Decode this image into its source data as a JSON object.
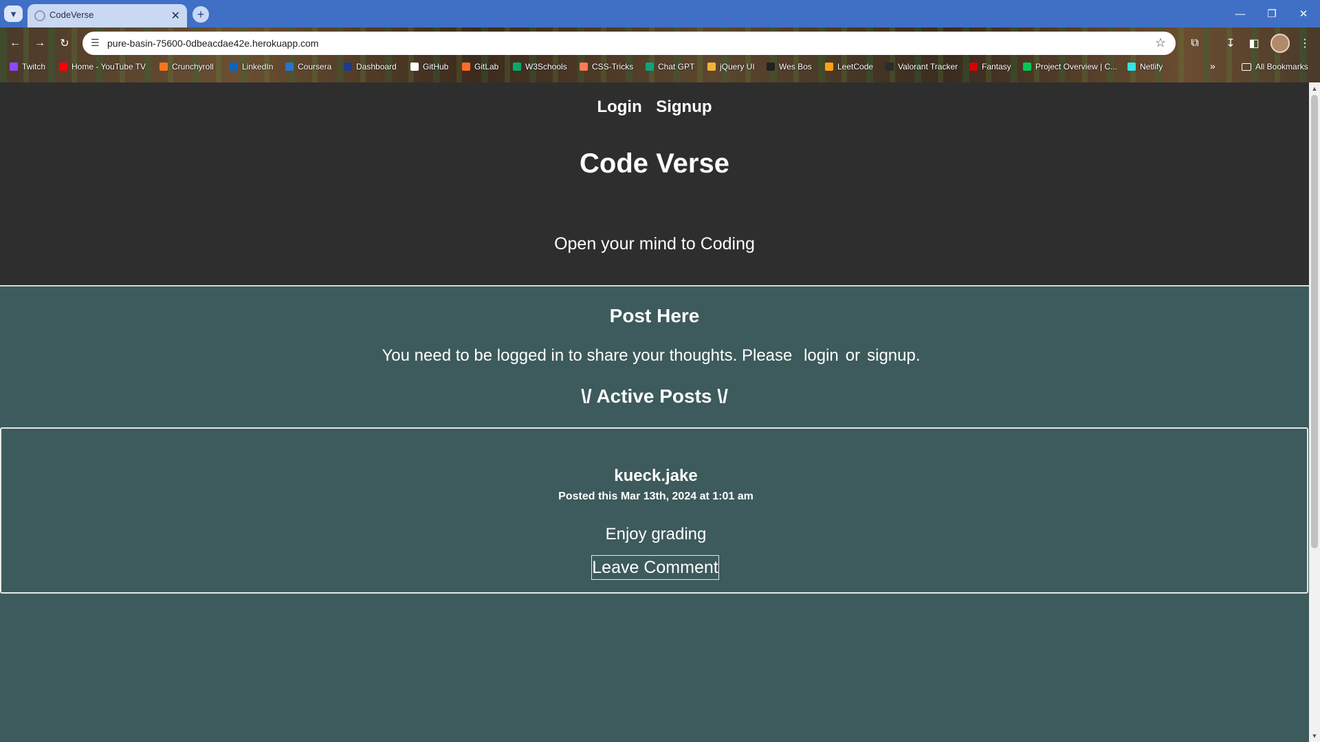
{
  "browser": {
    "tab_title": "CodeVerse",
    "new_tab_symbol": "+",
    "url": "pure-basin-75600-0dbeacdae42e.herokuapp.com",
    "bookmarks": [
      {
        "label": "Twitch",
        "icon": "twitch-icon",
        "color": "#9146ff"
      },
      {
        "label": "Home - YouTube TV",
        "icon": "youtube-icon",
        "color": "#ff0000"
      },
      {
        "label": "Crunchyroll",
        "icon": "crunchyroll-icon",
        "color": "#f47521"
      },
      {
        "label": "LinkedIn",
        "icon": "linkedin-icon",
        "color": "#0a66c2"
      },
      {
        "label": "Coursera",
        "icon": "coursera-icon",
        "color": "#2a73cc"
      },
      {
        "label": "Dashboard",
        "icon": "dashboard-icon",
        "color": "#1e3a8a"
      },
      {
        "label": "GitHub",
        "icon": "github-icon",
        "color": "#ffffff"
      },
      {
        "label": "GitLab",
        "icon": "gitlab-icon",
        "color": "#fc6d26"
      },
      {
        "label": "W3Schools",
        "icon": "w3schools-icon",
        "color": "#04aa6d"
      },
      {
        "label": "CSS-Tricks",
        "icon": "css-tricks-icon",
        "color": "#ff7a59"
      },
      {
        "label": "Chat GPT",
        "icon": "chatgpt-icon",
        "color": "#10a37f"
      },
      {
        "label": "jQuery UI",
        "icon": "jquery-icon",
        "color": "#f5b335"
      },
      {
        "label": "Wes Bos",
        "icon": "wes-bos-icon",
        "color": "#222222"
      },
      {
        "label": "LeetCode",
        "icon": "leetcode-icon",
        "color": "#ffa116"
      },
      {
        "label": "Valorant Tracker",
        "icon": "tracker-icon",
        "color": "#2b2b2b"
      },
      {
        "label": "Fantasy",
        "icon": "fantasy-icon",
        "color": "#d50000"
      },
      {
        "label": "Project Overview | C...",
        "icon": "project-icon",
        "color": "#00c853"
      },
      {
        "label": "Netlify",
        "icon": "netlify-icon",
        "color": "#32e6e2"
      }
    ],
    "all_bookmarks": "All Bookmarks"
  },
  "header": {
    "login": "Login",
    "signup": "Signup",
    "title": "Code Verse",
    "tagline": "Open your mind to Coding"
  },
  "post_form": {
    "heading": "Post Here",
    "message_prefix": "You need to be logged in to share your thoughts. Please",
    "login_link": "login",
    "or": "or",
    "signup_link": "signup."
  },
  "posts": {
    "heading": "\\/ Active Posts \\/",
    "items": [
      {
        "username": "kueck.jake",
        "date": "Posted this Mar 13th, 2024 at 1:01 am",
        "body": "Enjoy grading",
        "comment_button": "Leave Comment"
      }
    ]
  }
}
